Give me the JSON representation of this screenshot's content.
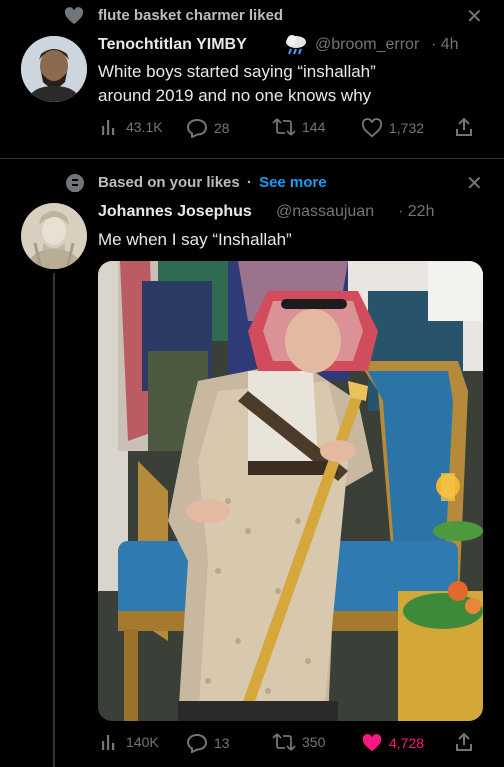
{
  "tweet1": {
    "context_label": "flute basket charmer liked",
    "author_name": "Tenochtitlan YIMBY",
    "author_handle": "@broom_error",
    "time": "· 4h",
    "text_line1": "White boys started saying “inshallah”",
    "text_line2": "around 2019 and no one knows why",
    "views": "43.1K",
    "replies": "28",
    "retweets": "144",
    "likes": "1,732"
  },
  "tweet2": {
    "context_label": "Based on your likes",
    "context_sep": "·",
    "see_more": "See more",
    "author_name": "Johannes Josephus",
    "author_handle": "@nassaujuan",
    "time": "· 22h",
    "text": "Me when I say “Inshallah”",
    "views": "140K",
    "replies": "13",
    "retweets": "350",
    "likes": "4,728"
  },
  "colors": {
    "background": "#000000",
    "muted": "#71767b",
    "link": "#1d9bf0",
    "liked": "#f91880"
  }
}
